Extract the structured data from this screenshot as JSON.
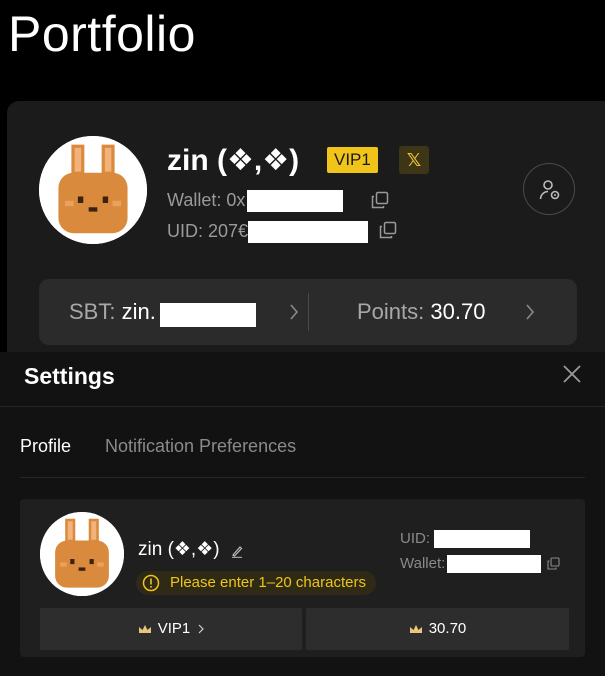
{
  "page": {
    "title": "Portfolio"
  },
  "profile": {
    "name": "zin (❖,❖)",
    "vip_label": "VIP1",
    "x_label": "𝕏",
    "wallet_label": "Wallet: 0x",
    "uid_label": "UID: 207€"
  },
  "stats": {
    "sbt_label": "SBT: ",
    "sbt_value": "zin.",
    "points_label": "Points: ",
    "points_value": "30.70"
  },
  "settings": {
    "title": "Settings",
    "tabs": [
      {
        "label": "Profile",
        "active": true
      },
      {
        "label": "Notification Preferences",
        "active": false
      }
    ],
    "card": {
      "name": "zin (❖,❖)",
      "warning": "Please enter 1–20 characters",
      "uid_label": "UID:",
      "wallet_label": "Wallet:",
      "vip_button": "VIP1",
      "points_button": "30.70"
    }
  },
  "colors": {
    "background": "#000000",
    "card": "#1b1b1b",
    "vip_yellow": "#f0c419",
    "warning_text": "#f0c419",
    "avatar_orange": "#d98a3d"
  },
  "icons": {
    "copy": "copy-icon",
    "profile_switch": "user-settings-icon",
    "close": "close-icon",
    "edit": "edit-icon",
    "warning": "warning-icon",
    "chevron": "chevron-right-icon",
    "crown": "crown-icon"
  }
}
